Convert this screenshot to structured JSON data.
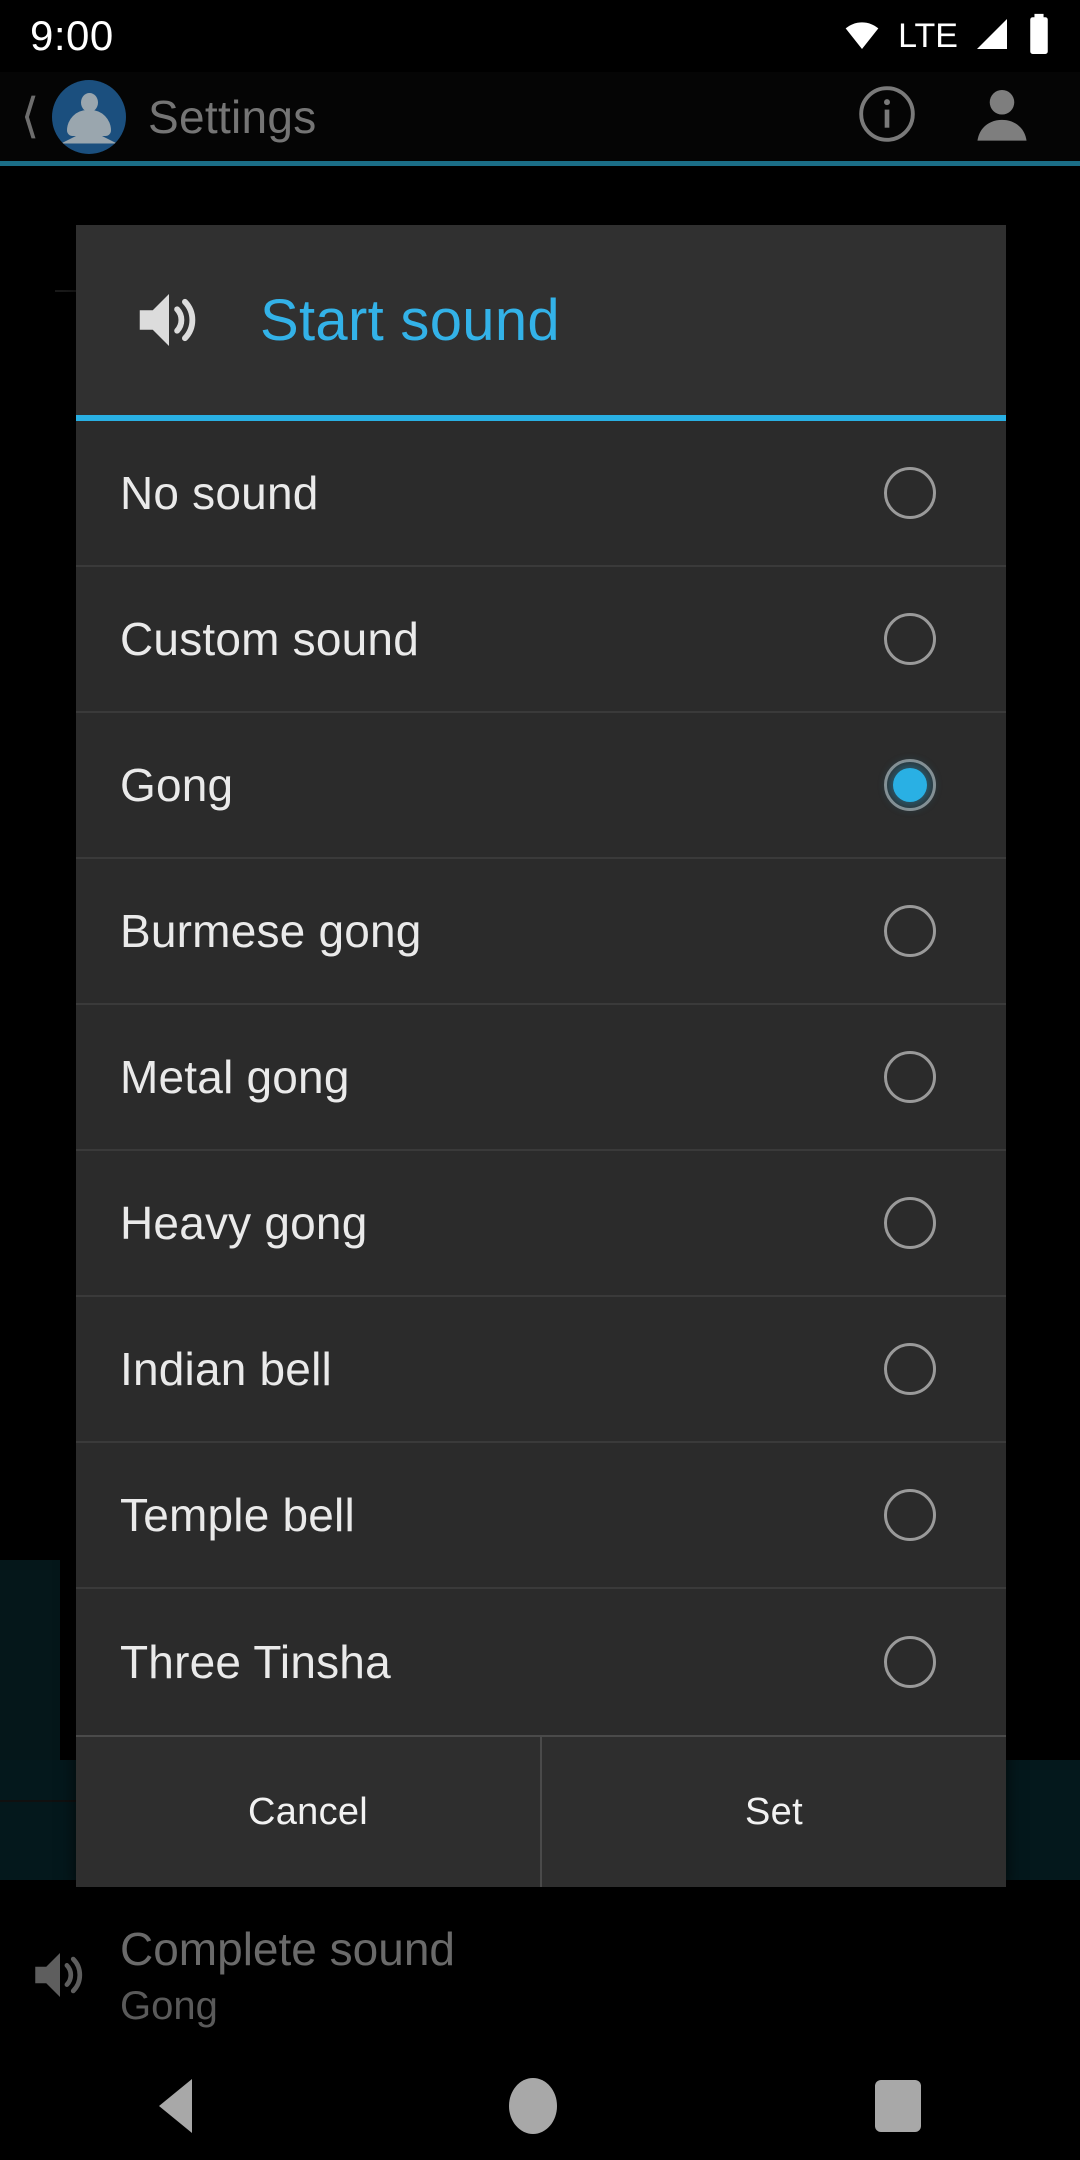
{
  "status_bar": {
    "time": "9:00",
    "network_label": "LTE",
    "icons": [
      "wifi-icon",
      "signal-icon",
      "battery-icon"
    ]
  },
  "app_bar": {
    "back_icon": "back-chevron-icon",
    "app_icon": "meditation-app-icon",
    "title": "Settings",
    "info_icon": "info-icon",
    "account_icon": "account-avatar-icon",
    "accent_color": "#1b6e87"
  },
  "background_content": {
    "complete_sound": {
      "icon": "speaker-icon",
      "title": "Complete sound",
      "value": "Gong"
    }
  },
  "dialog": {
    "icon": "speaker-volume-icon",
    "title": "Start sound",
    "title_color": "#33b2e8",
    "accent_color": "#29b0e4",
    "selected_value": "Gong",
    "options": [
      {
        "label": "No sound",
        "selected": false
      },
      {
        "label": "Custom sound",
        "selected": false
      },
      {
        "label": "Gong",
        "selected": true
      },
      {
        "label": "Burmese gong",
        "selected": false
      },
      {
        "label": "Metal gong",
        "selected": false
      },
      {
        "label": "Heavy gong",
        "selected": false
      },
      {
        "label": "Indian bell",
        "selected": false
      },
      {
        "label": "Temple bell",
        "selected": false
      },
      {
        "label": "Three Tinsha",
        "selected": false
      }
    ],
    "cancel_label": "Cancel",
    "set_label": "Set"
  },
  "nav_bar": {
    "back": "nav-back-icon",
    "home": "nav-home-icon",
    "recents": "nav-recents-icon"
  }
}
